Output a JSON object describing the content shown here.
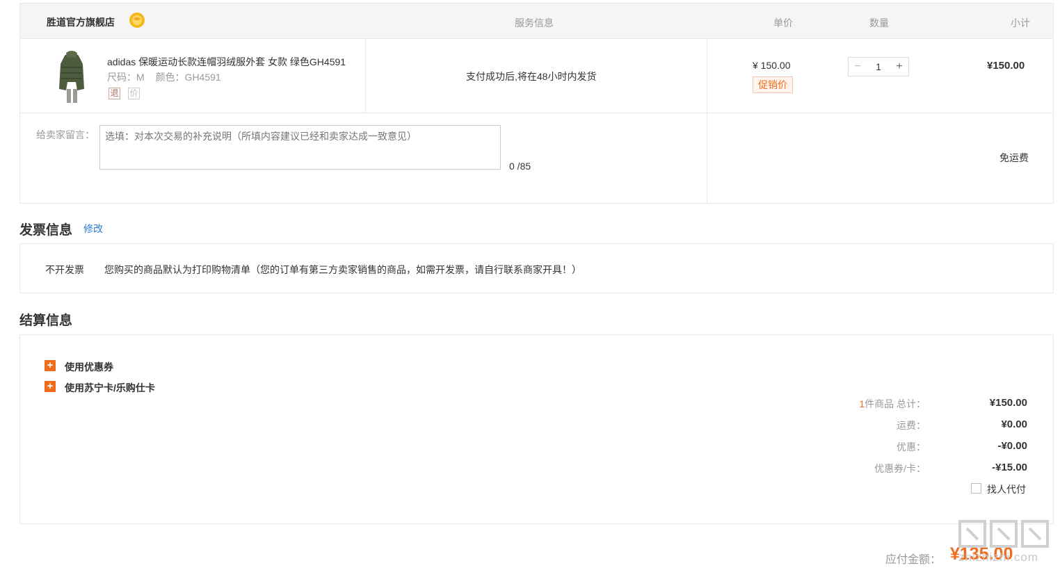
{
  "order": {
    "store_name": "胜道官方旗舰店",
    "headers": {
      "service": "服务信息",
      "unit_price": "单价",
      "quantity": "数量",
      "subtotal": "小计"
    },
    "item": {
      "title": "adidas 保暖运动长款连帽羽绒服外套 女款 绿色GH4591",
      "size_label": "尺码：M",
      "color_label": "颜色：GH4591",
      "tag_return": "退",
      "tag_price": "价",
      "service_text": "支付成功后,将在48小时内发货",
      "unit_price": "¥ 150.00",
      "promo_tag": "促销价",
      "quantity": "1",
      "qty_minus": "−",
      "qty_plus": "+",
      "subtotal": "¥150.00"
    },
    "message": {
      "label": "给卖家留言：",
      "placeholder": "选填：对本次交易的补充说明（所填内容建议已经和卖家达成一致意见）",
      "count": "0 /85"
    },
    "shipping_note": "免运费"
  },
  "invoice": {
    "title": "发票信息",
    "edit_link": "修改",
    "type": "不开发票",
    "description": "您购买的商品默认为打印购物清单（您的订单有第三方卖家销售的商品，如需开发票，请自行联系商家开具！）"
  },
  "settlement": {
    "title": "结算信息",
    "options": [
      {
        "icon": "+",
        "label": "使用优惠券"
      },
      {
        "icon": "+",
        "label": "使用苏宁卡/乐购仕卡"
      }
    ],
    "summary": {
      "count": "1",
      "total_label": "件商品 总计：",
      "total_value": "¥150.00",
      "shipping_label": "运费：",
      "shipping_value": "¥0.00",
      "discount_label": "优惠：",
      "discount_value": "-¥0.00",
      "coupon_label": "优惠券/卡：",
      "coupon_value": "-¥15.00"
    },
    "proxy_pay_label": "找人代付"
  },
  "payment": {
    "label": "应付金额：",
    "amount": "¥135.00"
  },
  "watermark_text": "zhizhizhi.com",
  "colors": {
    "accent": "#f06b1b",
    "link": "#2a7ad1",
    "border": "#e8e8e8",
    "header_bg": "#f5f5f5"
  }
}
